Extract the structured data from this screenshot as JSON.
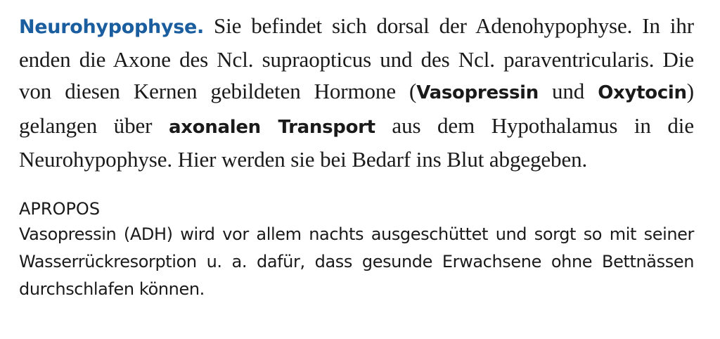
{
  "section": {
    "heading": "Neurohypophyse.",
    "text_1": " Sie befindet sich dorsal der Adenohypophyse. In ihr enden die Axone des Ncl. supraopticus und des Ncl. para­ventricularis. Die von diesen Kernen gebildeten Hormone (",
    "term_1": "Vaso­pressin",
    "text_2": " und ",
    "term_2": "Oxytocin",
    "text_3": ") gelangen über ",
    "term_3": "axonalen Transport",
    "text_4": " aus dem Hypothalamus in die Neurohypophyse. Hier werden sie bei Bedarf ins Blut abgegeben."
  },
  "apropos": {
    "title": "APROPOS",
    "text": "Vasopressin (ADH) wird vor allem nachts ausgeschüttet und sorgt so mit seiner Wasserrückresorption u. a. dafür, dass gesunde Erwachsene ohne Bettnässen durchschlafen können."
  }
}
